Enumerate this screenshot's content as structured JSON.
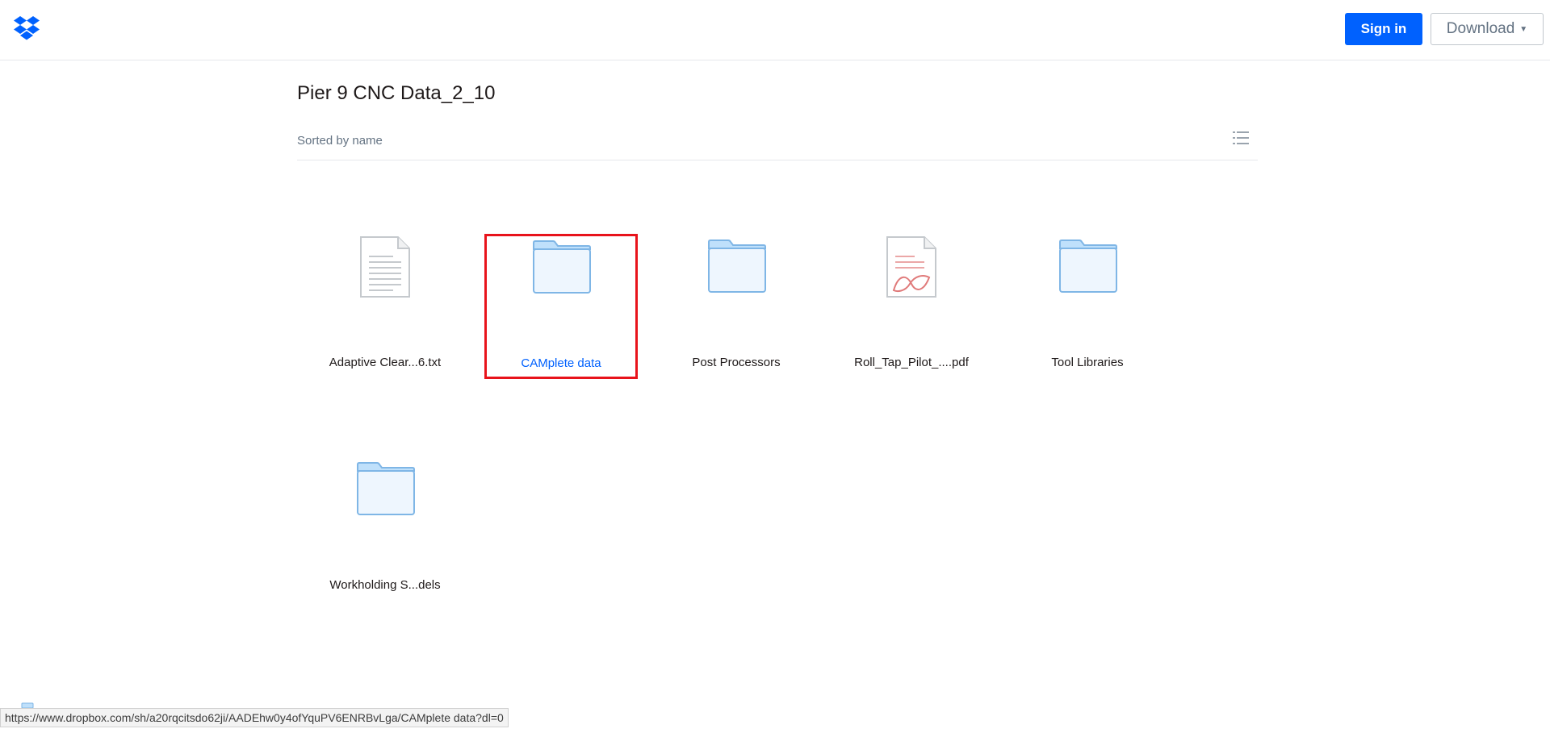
{
  "header": {
    "logo_icon": "dropbox-logo-icon",
    "signin_label": "Sign in",
    "download_label": "Download",
    "download_caret_icon": "caret-down-icon",
    "brand_color": "#0061fe"
  },
  "folder": {
    "title": "Pier 9 CNC Data_2_10",
    "sort_label": "Sorted by name",
    "view_toggle_icon": "list-view-icon"
  },
  "items": [
    {
      "name": "Adaptive Clear...6.txt",
      "icon": "text-file-icon"
    },
    {
      "name": "CAMplete data",
      "icon": "folder-icon",
      "selected": true
    },
    {
      "name": "Post Processors",
      "icon": "folder-icon"
    },
    {
      "name": "Roll_Tap_Pilot_....pdf",
      "icon": "pdf-file-icon"
    },
    {
      "name": "Tool Libraries",
      "icon": "folder-icon"
    },
    {
      "name": "Workholding S...dels",
      "icon": "folder-icon"
    }
  ],
  "status_bar": {
    "url": "https://www.dropbox.com/sh/a20rqcitsdo62ji/AADEhw0y4ofYquPV6ENRBvLga/CAMplete data?dl=0"
  },
  "colors": {
    "selection_outline": "#e8131b",
    "folder_blue": "#92ceff",
    "link_blue": "#0061fe"
  }
}
